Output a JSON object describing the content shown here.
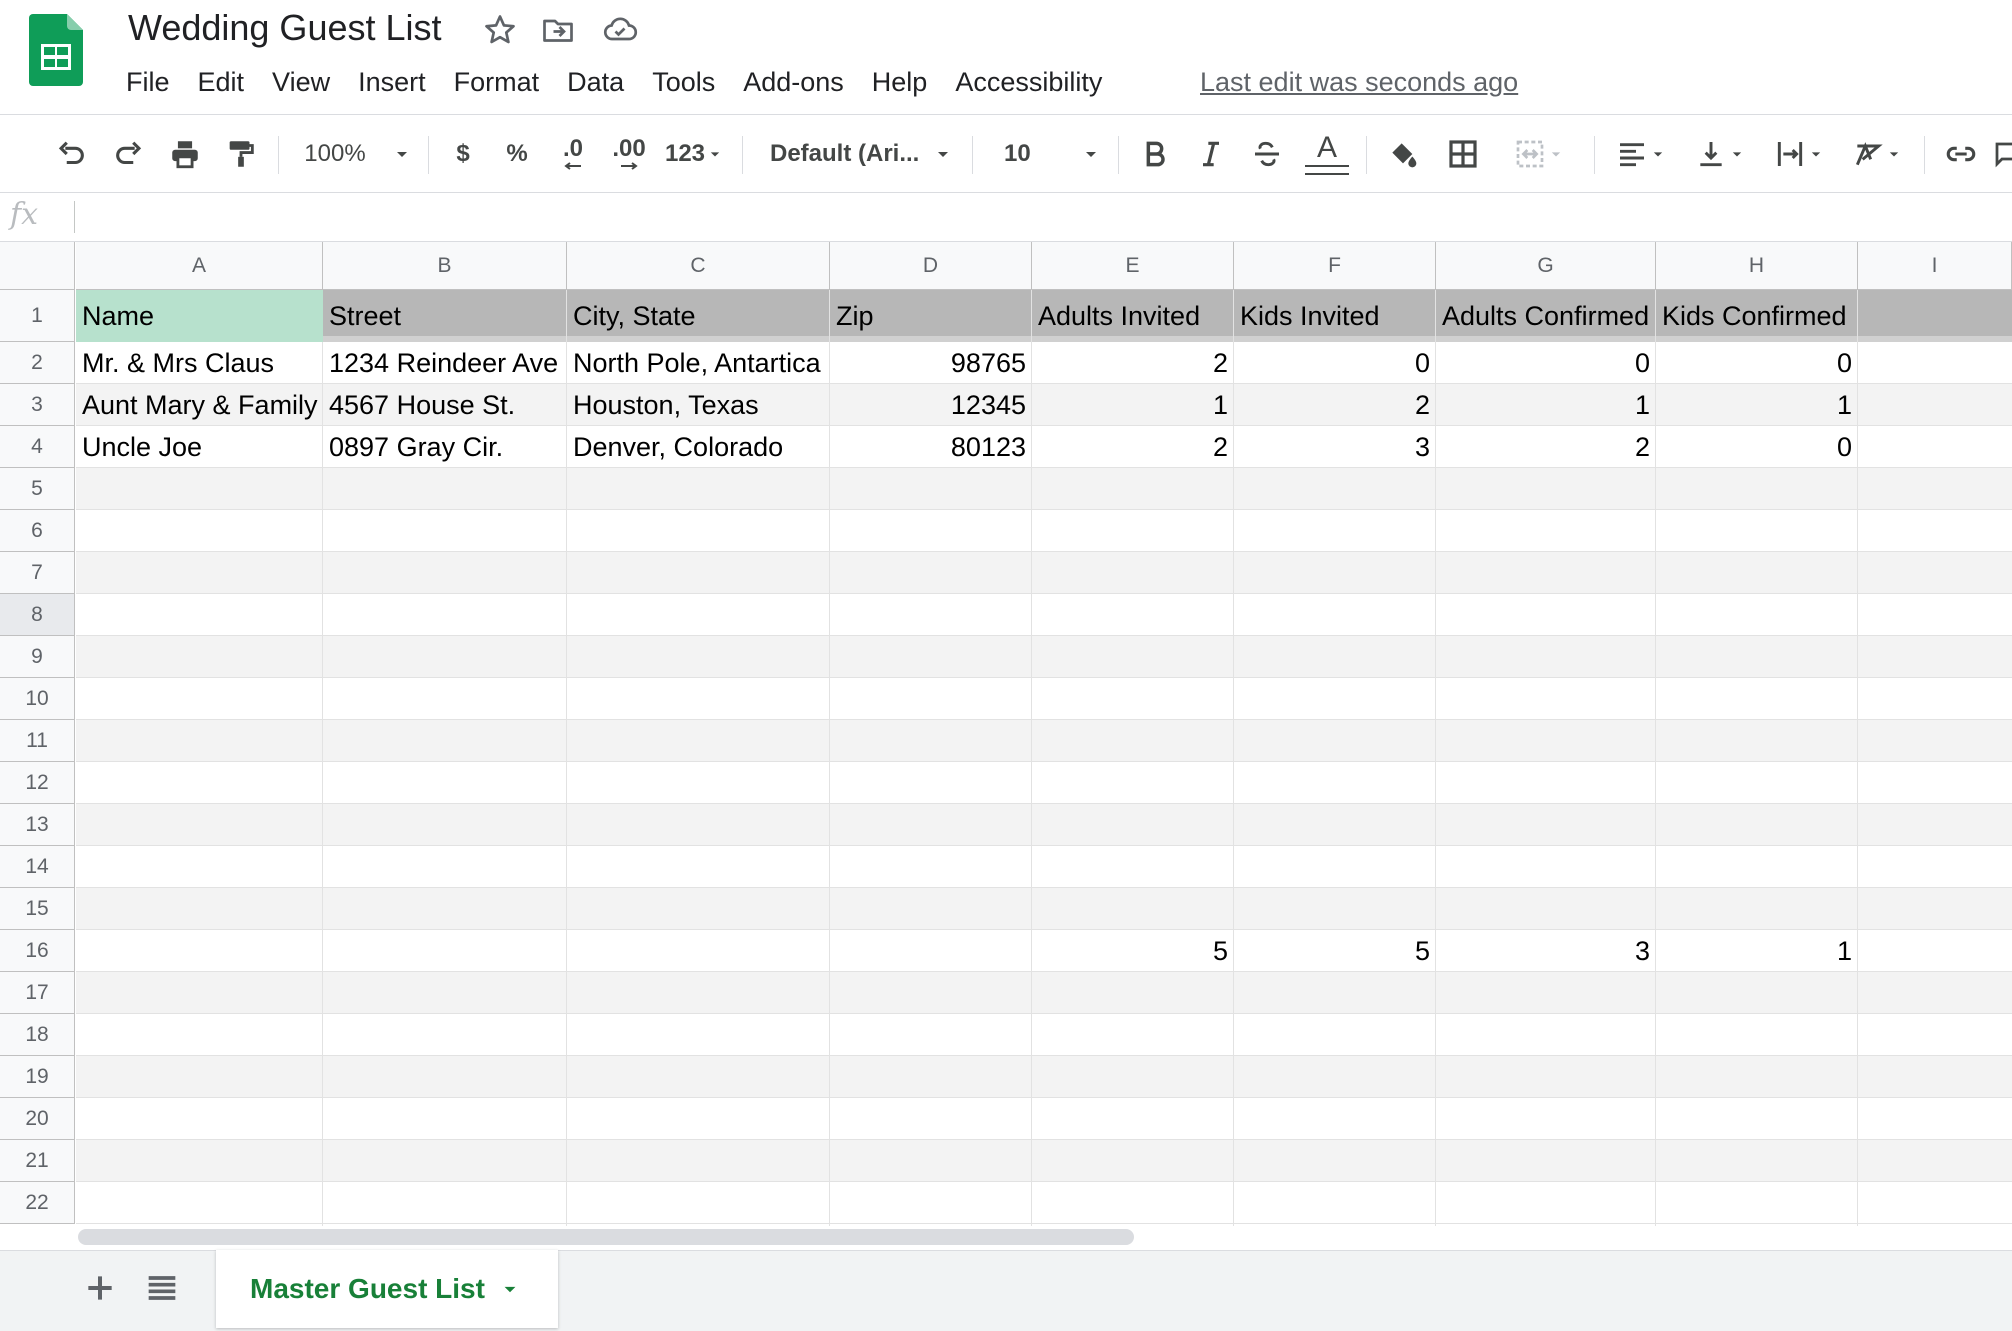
{
  "app": {
    "doc_title": "Wedding Guest List",
    "menu": [
      "File",
      "Edit",
      "View",
      "Insert",
      "Format",
      "Data",
      "Tools",
      "Add-ons",
      "Help",
      "Accessibility"
    ],
    "last_edit": "Last edit was seconds ago",
    "brand_color": "#0f9d58"
  },
  "toolbar": {
    "zoom": "100%",
    "currency": "$",
    "percent": "%",
    "decimal_decrease": ".0",
    "decimal_increase": ".00",
    "more_formats": "123",
    "font": "Default (Ari...",
    "font_size": "10",
    "text_color_glyph": "A",
    "icons": [
      "undo-icon",
      "redo-icon",
      "print-icon",
      "paint-format-icon",
      "bold-icon",
      "italic-icon",
      "strikethrough-icon",
      "text-color-icon",
      "fill-color-icon",
      "borders-icon",
      "merge-cells-icon",
      "align-left-icon",
      "valign-bottom-icon",
      "text-wrap-icon",
      "text-rotate-icon",
      "link-icon",
      "comment-icon"
    ]
  },
  "formula_bar": {
    "fx": "fx",
    "value": ""
  },
  "grid": {
    "columns": [
      "A",
      "B",
      "C",
      "D",
      "E",
      "F",
      "G",
      "H",
      "I"
    ],
    "rows": [
      "1",
      "2",
      "3",
      "4",
      "5",
      "6",
      "7",
      "8",
      "9",
      "10",
      "11",
      "12",
      "13",
      "14",
      "15",
      "16",
      "17",
      "18",
      "19",
      "20",
      "21",
      "22"
    ],
    "header_row": [
      "Name",
      "Street",
      "City, State",
      "Zip",
      "Adults Invited",
      "Kids Invited",
      "Adults Confirmed",
      "Kids Confirmed"
    ],
    "data": [
      [
        "Mr. & Mrs Claus",
        "1234 Reindeer Ave",
        "North Pole, Antartica",
        "98765",
        "2",
        "0",
        "0",
        "0"
      ],
      [
        "Aunt Mary & Family",
        "4567 House St.",
        "Houston, Texas",
        "12345",
        "1",
        "2",
        "1",
        "1"
      ],
      [
        "Uncle Joe",
        "0897 Gray Cir.",
        "Denver, Colorado",
        "80123",
        "2",
        "3",
        "2",
        "0"
      ]
    ],
    "totals_row_label": "16",
    "totals": [
      "5",
      "5",
      "3",
      "1"
    ],
    "header_bg": "#b7b7b7",
    "selected_header_bg": "#b7e1cd",
    "band_color": "#f3f3f3"
  },
  "sheets": {
    "active": "Master Guest List"
  }
}
